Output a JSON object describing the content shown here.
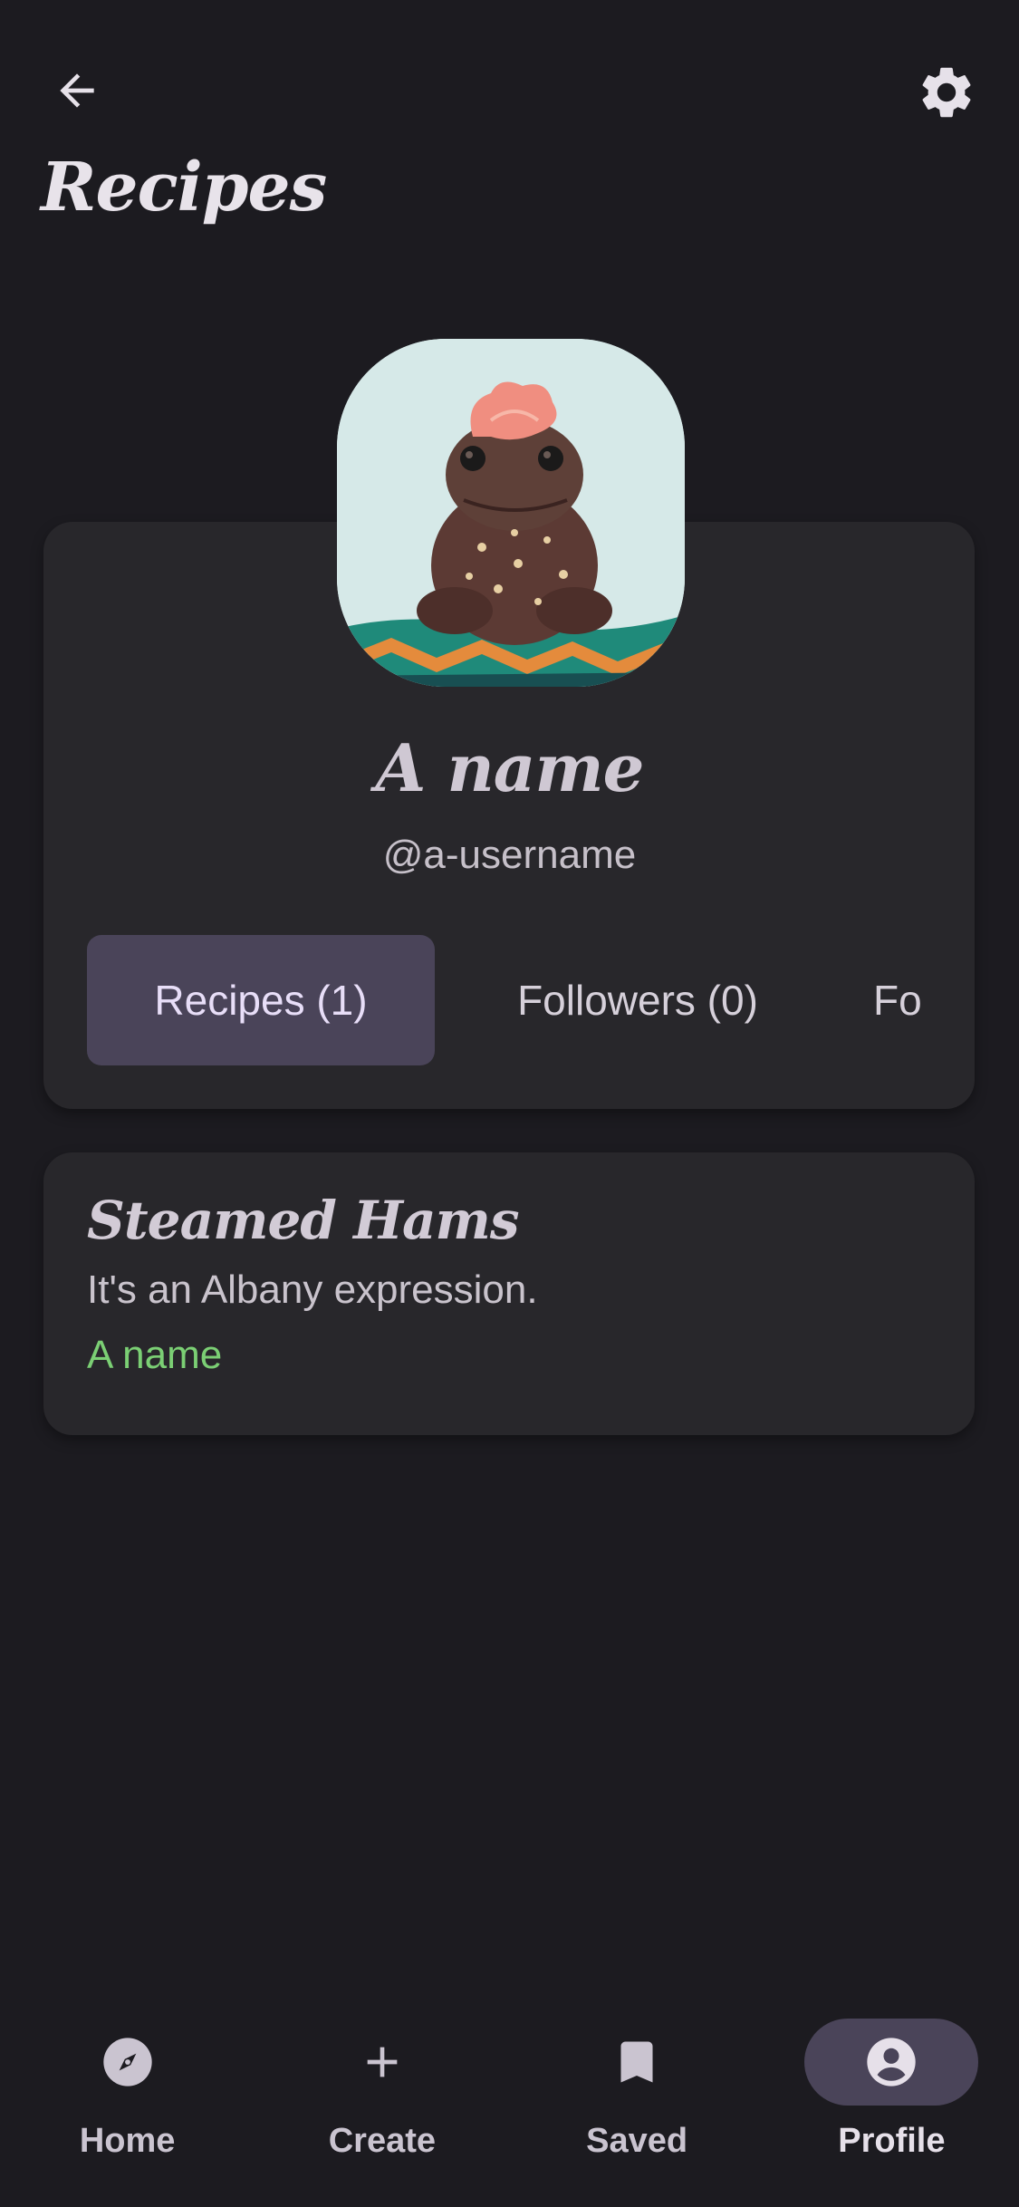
{
  "header": {
    "title": "Recipes",
    "back_icon": "arrow-back-icon",
    "settings_icon": "gear-icon"
  },
  "profile": {
    "name": "A name",
    "username": "@a-username",
    "avatar": "toad-with-flower-avatar",
    "tabs": [
      {
        "label": "Recipes (1)",
        "active": true
      },
      {
        "label": "Followers (0)",
        "active": false
      },
      {
        "label": "Fo",
        "active": false
      }
    ]
  },
  "recipes": [
    {
      "title": "Steamed Hams",
      "description": "It's an Albany expression.",
      "author": "A name"
    }
  ],
  "nav": {
    "items": [
      {
        "label": "Home",
        "icon": "compass-icon",
        "active": false
      },
      {
        "label": "Create",
        "icon": "plus-icon",
        "active": false
      },
      {
        "label": "Saved",
        "icon": "bookmark-icon",
        "active": false
      },
      {
        "label": "Profile",
        "icon": "account-circle-icon",
        "active": true
      }
    ]
  },
  "colors": {
    "background": "#1c1b20",
    "card": "#28272b",
    "accent_container": "#4a4459",
    "author_link": "#7bcf74"
  }
}
